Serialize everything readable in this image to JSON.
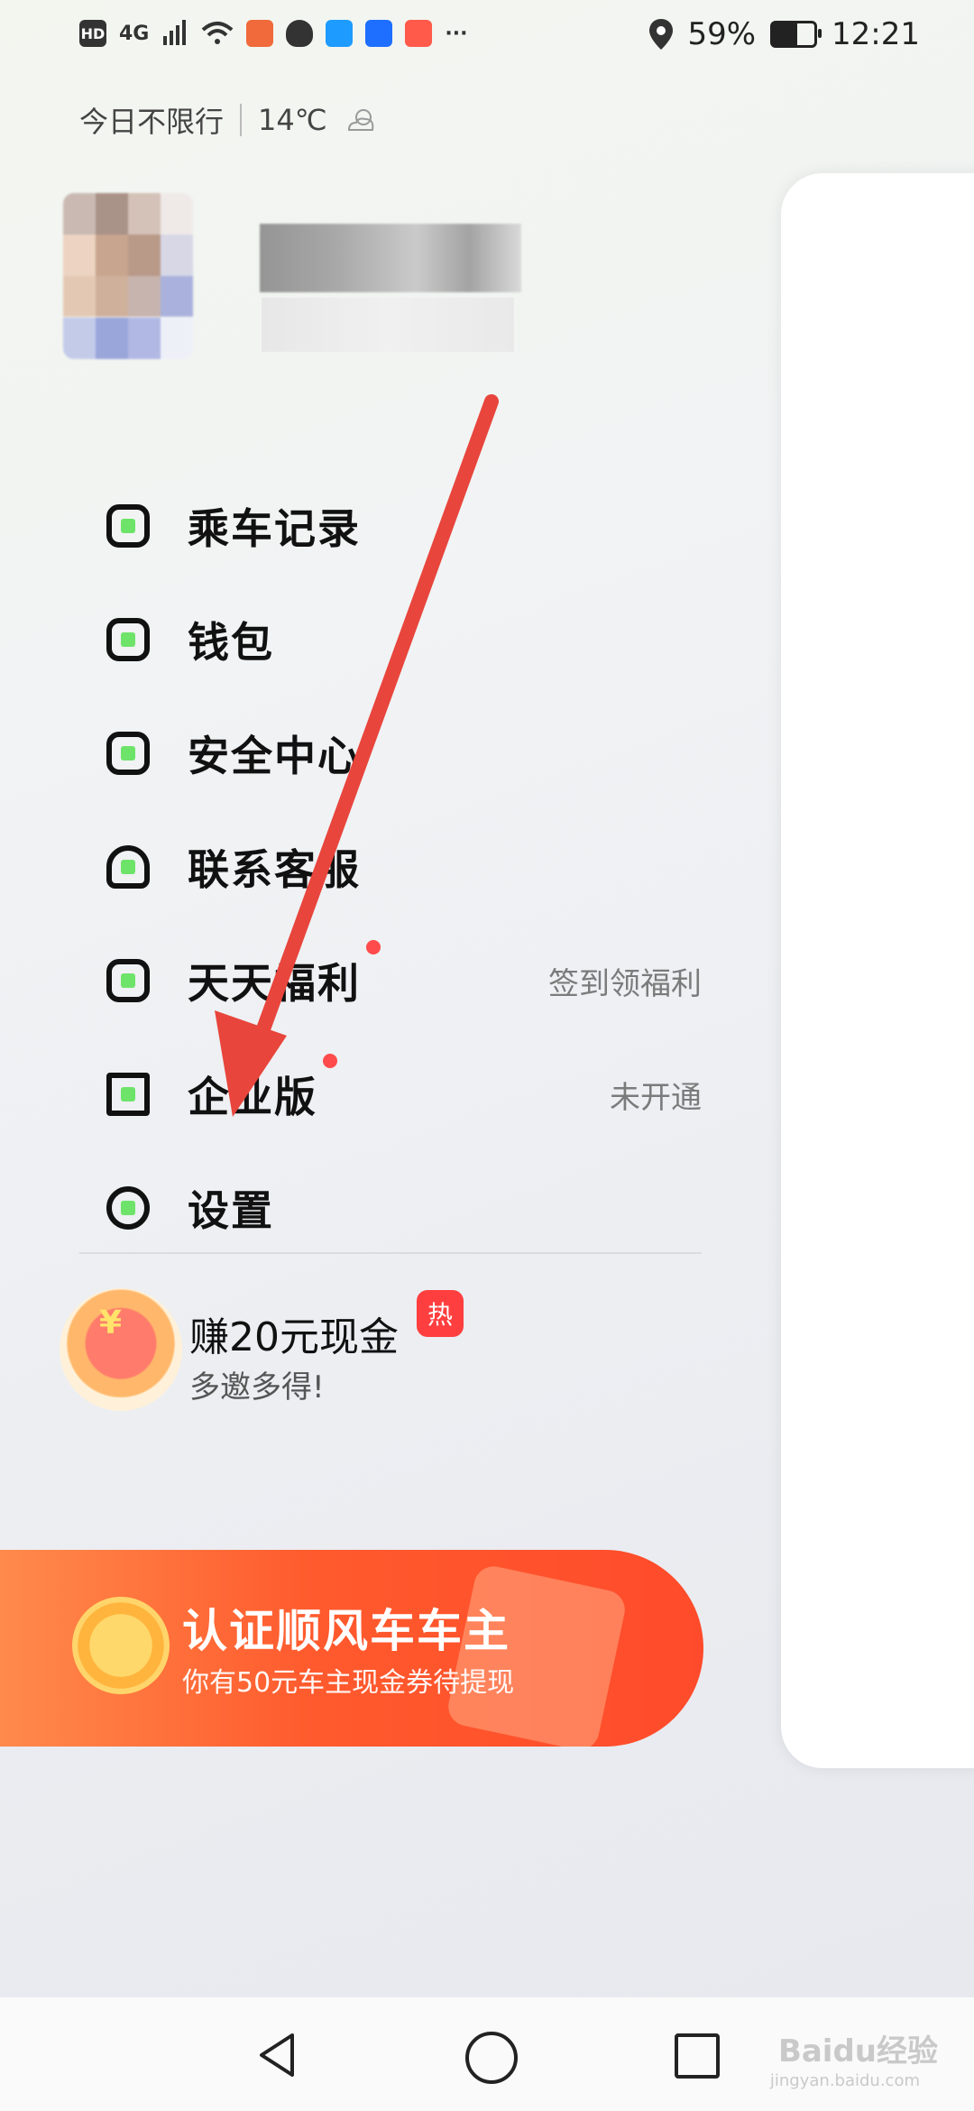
{
  "status_bar": {
    "left_items": [
      "HD",
      "4G"
    ],
    "battery_percent": "59%",
    "battery_level": 0.59,
    "time": "12:21",
    "more": "···"
  },
  "weather": {
    "restriction": "今日不限行",
    "temperature": "14℃",
    "icon": "partly-cloudy-icon"
  },
  "menu": {
    "items": [
      {
        "label": "乘车记录",
        "icon": "ride-history-icon",
        "extra": ""
      },
      {
        "label": "钱包",
        "icon": "wallet-icon",
        "extra": ""
      },
      {
        "label": "安全中心",
        "icon": "shield-check-icon",
        "extra": ""
      },
      {
        "label": "联系客服",
        "icon": "headset-icon",
        "extra": ""
      },
      {
        "label": "天天福利",
        "icon": "gift-icon",
        "extra": "签到领福利",
        "badge": true
      },
      {
        "label": "企业版",
        "icon": "enterprise-icon",
        "extra": "未开通",
        "badge": true
      },
      {
        "label": "设置",
        "icon": "settings-icon",
        "extra": ""
      }
    ]
  },
  "promo": {
    "title": "赚20元现金",
    "hot": "热",
    "subtitle": "多邀多得!"
  },
  "banner": {
    "title": "认证顺风车车主",
    "subtitle": "你有50元车主现金券待提现"
  },
  "watermark": {
    "brand": "Baidu经验",
    "url": "jingyan.baidu.com"
  },
  "colors": {
    "accent_red": "#ff4b2b",
    "icon_green": "#6ee36a",
    "arrow_red": "#e8453c"
  }
}
